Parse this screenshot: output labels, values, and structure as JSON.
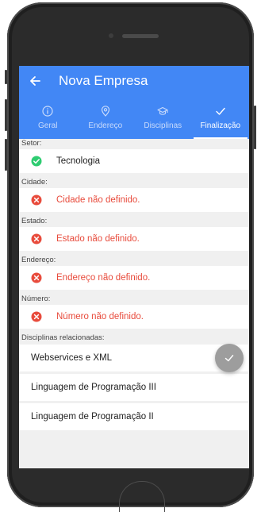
{
  "header": {
    "back_icon": "arrow-left-icon",
    "title": "Nova Empresa"
  },
  "tabs": [
    {
      "label": "Geral",
      "icon": "info-icon",
      "active": false
    },
    {
      "label": "Endereço",
      "icon": "map-pin-icon",
      "active": false
    },
    {
      "label": "Disciplinas",
      "icon": "graduation-cap-icon",
      "active": false
    },
    {
      "label": "Finalização",
      "icon": "check-icon",
      "active": true
    }
  ],
  "fields": [
    {
      "label": "Setor:",
      "value": "Tecnologia",
      "status": "ok"
    },
    {
      "label": "Cidade:",
      "value": "Cidade não definido.",
      "status": "error"
    },
    {
      "label": "Estado:",
      "value": "Estado não definido.",
      "status": "error"
    },
    {
      "label": "Endereço:",
      "value": "Endereço não definido.",
      "status": "error"
    },
    {
      "label": "Número:",
      "value": "Número não definido.",
      "status": "error"
    }
  ],
  "disciplines": {
    "label": "Disciplinas relacionadas:",
    "items": [
      "Webservices e XML",
      "Linguagem de Programação III",
      "Linguagem de Programação II"
    ]
  },
  "fab": {
    "icon": "check-icon"
  },
  "colors": {
    "primary": "#4287f5",
    "error": "#e84b3c",
    "success": "#2ecc71",
    "fab": "#9d9d9d"
  }
}
